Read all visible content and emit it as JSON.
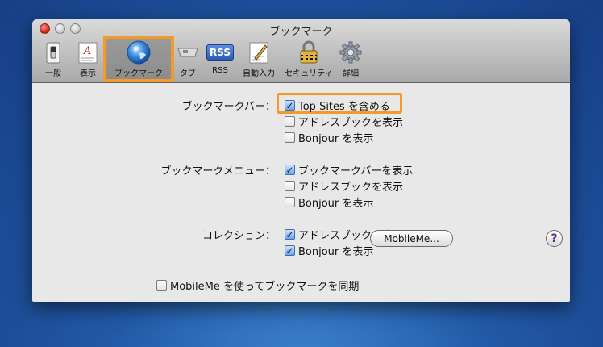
{
  "window": {
    "title": "ブックマーク"
  },
  "toolbar": {
    "items": [
      {
        "label": "一般",
        "icon": "switch-icon"
      },
      {
        "label": "表示",
        "icon": "font-icon"
      },
      {
        "label": "ブックマーク",
        "icon": "globe-icon",
        "selected": true
      },
      {
        "label": "タブ",
        "icon": "tab-icon"
      },
      {
        "label": "RSS",
        "icon": "rss-icon",
        "icon_text": "RSS"
      },
      {
        "label": "自動入力",
        "icon": "pen-icon"
      },
      {
        "label": "セキュリティ",
        "icon": "lock-icon"
      },
      {
        "label": "詳細",
        "icon": "gear-icon"
      }
    ]
  },
  "groups": {
    "bar": {
      "label": "ブックマークバー：",
      "options": [
        {
          "label": "Top Sites を含める",
          "checked": true
        },
        {
          "label": "アドレスブックを表示",
          "checked": false
        },
        {
          "label": "Bonjour を表示",
          "checked": false
        }
      ]
    },
    "menu": {
      "label": "ブックマークメニュー：",
      "options": [
        {
          "label": "ブックマークバーを表示",
          "checked": true
        },
        {
          "label": "アドレスブックを表示",
          "checked": false
        },
        {
          "label": "Bonjour を表示",
          "checked": false
        }
      ]
    },
    "collection": {
      "label": "コレクション：",
      "options": [
        {
          "label": "アドレスブックを表示",
          "checked": true
        },
        {
          "label": "Bonjour を表示",
          "checked": true
        }
      ]
    }
  },
  "sync": {
    "label": "MobileMe を使ってブックマークを同期",
    "checked": false,
    "button_label": "MobileMe..."
  },
  "help": {
    "label": "?"
  },
  "colors": {
    "highlight": "#f39a2a",
    "checkbox_checked": "#6ea6ea"
  }
}
